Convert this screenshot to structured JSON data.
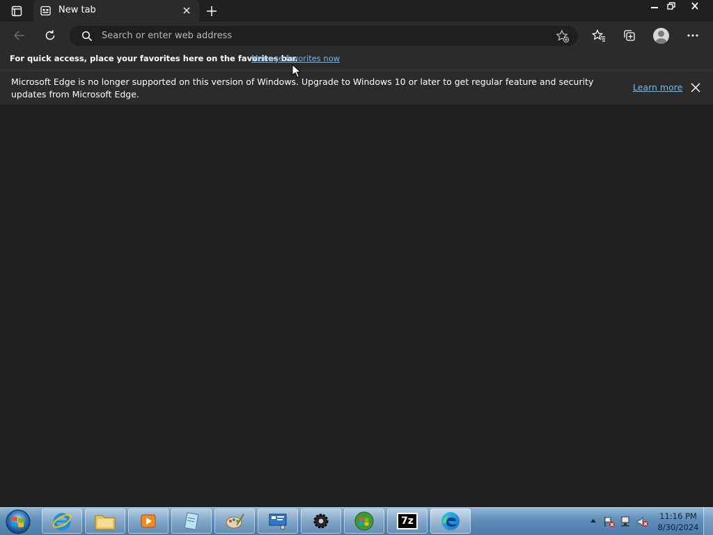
{
  "browser": {
    "tab_title": "New tab",
    "address_placeholder": "Search or enter web address"
  },
  "favorites_bar": {
    "message": "For quick access, place your favorites here on the favorites bar.",
    "link": "Manage favorites now"
  },
  "info_bar": {
    "message": "Microsoft Edge is no longer supported on this version of Windows. Upgrade to Windows 10 or later to get regular feature and security updates from Microsoft Edge.",
    "link": "Learn more"
  },
  "taskbar": {
    "time": "11:16 PM",
    "date": "8/30/2024",
    "seven_zip_label": "7z"
  },
  "colors": {
    "background": "#202020",
    "toolbar": "#2b2b2b",
    "link": "#76b9ed"
  }
}
